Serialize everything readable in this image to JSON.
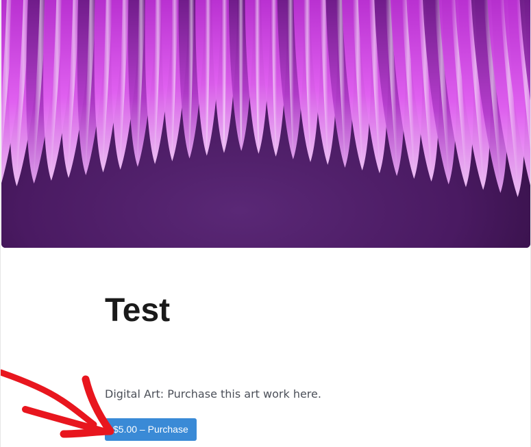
{
  "hero_image": {
    "icon": "abstract-purple-waves-image"
  },
  "post": {
    "title": "Test",
    "description": "Digital Art: Purchase this art work here.",
    "buy_button_label": "$5.00 – Purchase"
  },
  "annotation": {
    "icon": "red-arrow-pointer",
    "color": "#e8161e"
  },
  "colors": {
    "button": "#3a8ad6",
    "hero_dark": "#3d1552",
    "hero_accent": "#e04df0"
  }
}
